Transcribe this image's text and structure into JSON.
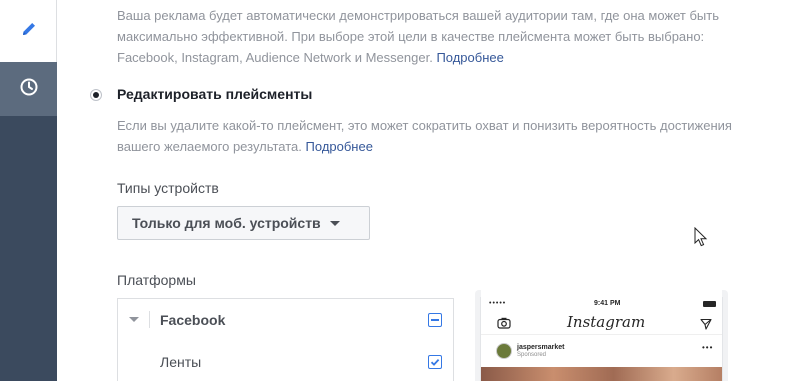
{
  "sidebar": {
    "items": [
      {
        "name": "edit",
        "icon": "pencil-icon",
        "color": "#3578e5"
      },
      {
        "name": "history",
        "icon": "clock-icon",
        "color": "#ffffff"
      }
    ]
  },
  "auto_placement": {
    "description": "Ваша реклама будет автоматически демонстрироваться вашей аудитории там, где она может быть максимально эффективной. При выборе этой цели в качестве плейсмента может быть выбрано: Facebook, Instagram, Audience Network и Messenger.",
    "link": "Подробнее"
  },
  "edit_placements": {
    "label": "Редактировать плейсменты",
    "description": "Если вы удалите какой-то плейсмент, это может сократить охват и понизить вероятность достижения вашего желаемого результата.",
    "link": "Подробнее"
  },
  "device_types": {
    "label": "Типы устройств",
    "selected": "Только для моб. устройств"
  },
  "platforms": {
    "label": "Платформы",
    "items": [
      {
        "name": "Facebook",
        "state": "partial"
      },
      {
        "name": "Ленты",
        "state": "checked"
      }
    ]
  },
  "preview": {
    "status_dots": "•••••",
    "time": "9:41 PM",
    "app_name": "Instagram",
    "account": "jaspersmarket",
    "sponsored": "Sponsored",
    "more": "•••"
  },
  "colors": {
    "link": "#365899",
    "accent": "#3578e5",
    "sidebar": "#3b4a5e"
  }
}
